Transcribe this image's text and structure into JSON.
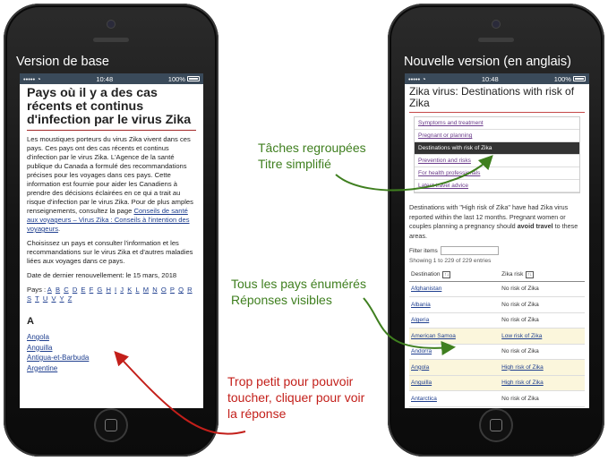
{
  "left_phone": {
    "caption": "Version de base",
    "status": {
      "signal": "•••••",
      "wifi": "◔",
      "time": "10:48",
      "battery": "100%"
    },
    "page": {
      "title": "Pays où il y a des cas récents et continus d'infection par le virus Zika",
      "para1": "Les moustiques porteurs du virus Zika vivent dans ces pays. Ces pays ont des cas récents et continus d'infection par le virus Zika. L'Agence de la santé publique du Canada a formulé des recommandations précises pour les voyages dans ces pays. Cette information est fournie pour aider les Canadiens à prendre des décisions éclairées en ce qui a trait au risque d'infection par le virus Zika. Pour de plus amples renseignements, consultez la page ",
      "para1_link": "Conseils de santé aux voyageurs – Virus Zika : Conseils à l'intention des voyageurs",
      "para1_end": ".",
      "para2": "Choisissez un pays et consulter l'information et les recommandations sur le virus Zika et d'autres maladies liées aux voyages dans ce pays.",
      "date": "Date de dernier renouvellement: le 15 mars, 2018",
      "alpha_label": "Pays : ",
      "alpha": [
        "A",
        "B",
        "C",
        "D",
        "E",
        "F",
        "G",
        "H",
        "I",
        "J",
        "K",
        "L",
        "M",
        "N",
        "O",
        "P",
        "Q",
        "R",
        "S",
        "T",
        "U",
        "V",
        "Y",
        "Z"
      ],
      "section": "A",
      "countries": [
        "Angola",
        "Anguilla",
        "Antigua-et-Barbuda",
        "Argentine"
      ]
    }
  },
  "right_phone": {
    "caption": "Nouvelle version (en anglais)",
    "status": {
      "signal": "•••••",
      "wifi": "◔",
      "time": "10:48",
      "battery": "100%"
    },
    "page": {
      "title": "Zika virus: Destinations with risk of Zika",
      "nav": [
        "Symptoms and treatment",
        "Pregnant or planning",
        "Destinations with risk of Zika",
        "Prevention and risks",
        "For health professionals",
        "Latest travel advice"
      ],
      "nav_active_index": 2,
      "intro_a": "Destinations with \"High risk of Zika\" have had Zika virus reported within the last 12 months. Pregnant women or couples planning a pregnancy should ",
      "intro_b": "avoid travel",
      "intro_c": " to these areas.",
      "filter_label": "Filter items",
      "showing": "Showing 1 to 229 of 229 entries",
      "table": {
        "col1": "Destination",
        "col2": "Zika risk",
        "sort_icon": "↑↓",
        "rows": [
          {
            "dest": "Afghanistan",
            "risk": "No risk of Zika",
            "highlight": false,
            "risk_link": false
          },
          {
            "dest": "Albania",
            "risk": "No risk of Zika",
            "highlight": false,
            "risk_link": false
          },
          {
            "dest": "Algeria",
            "risk": "No risk of Zika",
            "highlight": false,
            "risk_link": false
          },
          {
            "dest": "American Samoa",
            "risk": "Low risk of Zika",
            "highlight": true,
            "risk_link": true
          },
          {
            "dest": "Andorra",
            "risk": "No risk of Zika",
            "highlight": false,
            "risk_link": false
          },
          {
            "dest": "Angola",
            "risk": "High risk of Zika",
            "highlight": true,
            "risk_link": true
          },
          {
            "dest": "Anguilla",
            "risk": "High risk of Zika",
            "highlight": true,
            "risk_link": true
          },
          {
            "dest": "Antarctica",
            "risk": "No risk of Zika",
            "highlight": false,
            "risk_link": false
          }
        ]
      }
    }
  },
  "annotations": {
    "grouped": [
      "Tâches regroupées",
      "Titre simplifié"
    ],
    "listed": [
      "Tous les pays énumérés",
      "Réponses visibles"
    ],
    "too_small": [
      "Trop petit pour pouvoir",
      "toucher, cliquer pour voir",
      "la réponse"
    ]
  },
  "colors": {
    "green": "#3f7f1f",
    "red": "#c31f1a",
    "status_bar": "#3a4a5a",
    "nav_active": "#333333",
    "highlight": "#fbf6dc"
  }
}
